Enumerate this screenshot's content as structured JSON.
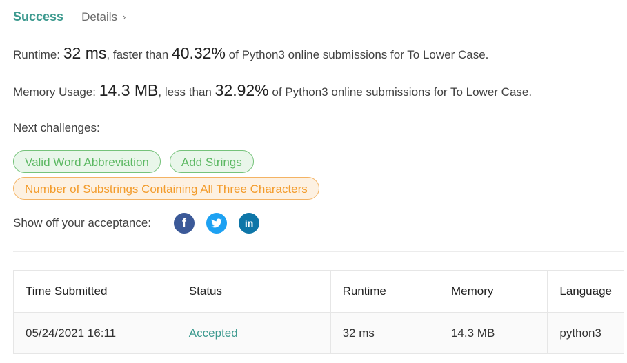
{
  "header": {
    "status": "Success",
    "details_label": "Details",
    "chevron": "›"
  },
  "runtime": {
    "label": "Runtime:",
    "value": "32 ms",
    "comparison": ", faster than",
    "percent": "40.32%",
    "suffix": "of Python3 online submissions for To Lower Case."
  },
  "memory": {
    "label": "Memory Usage:",
    "value": "14.3 MB",
    "comparison": ", less than",
    "percent": "32.92%",
    "suffix": "of Python3 online submissions for To Lower Case."
  },
  "next_challenges": {
    "label": "Next challenges:",
    "items": [
      {
        "label": "Valid Word Abbreviation",
        "difficulty_color": "green"
      },
      {
        "label": "Add Strings",
        "difficulty_color": "green"
      },
      {
        "label": "Number of Substrings Containing All Three Characters",
        "difficulty_color": "orange"
      }
    ]
  },
  "share": {
    "label": "Show off your acceptance:",
    "icons": [
      "facebook-icon",
      "twitter-icon",
      "linkedin-icon"
    ]
  },
  "table": {
    "headers": [
      "Time Submitted",
      "Status",
      "Runtime",
      "Memory",
      "Language"
    ],
    "rows": [
      {
        "time": "05/24/2021 16:11",
        "status": "Accepted",
        "runtime": "32 ms",
        "memory": "14.3 MB",
        "language": "python3"
      }
    ]
  },
  "colors": {
    "success": "#3d9a8f",
    "easy": "#5cb863",
    "medium": "#f39c2c"
  }
}
